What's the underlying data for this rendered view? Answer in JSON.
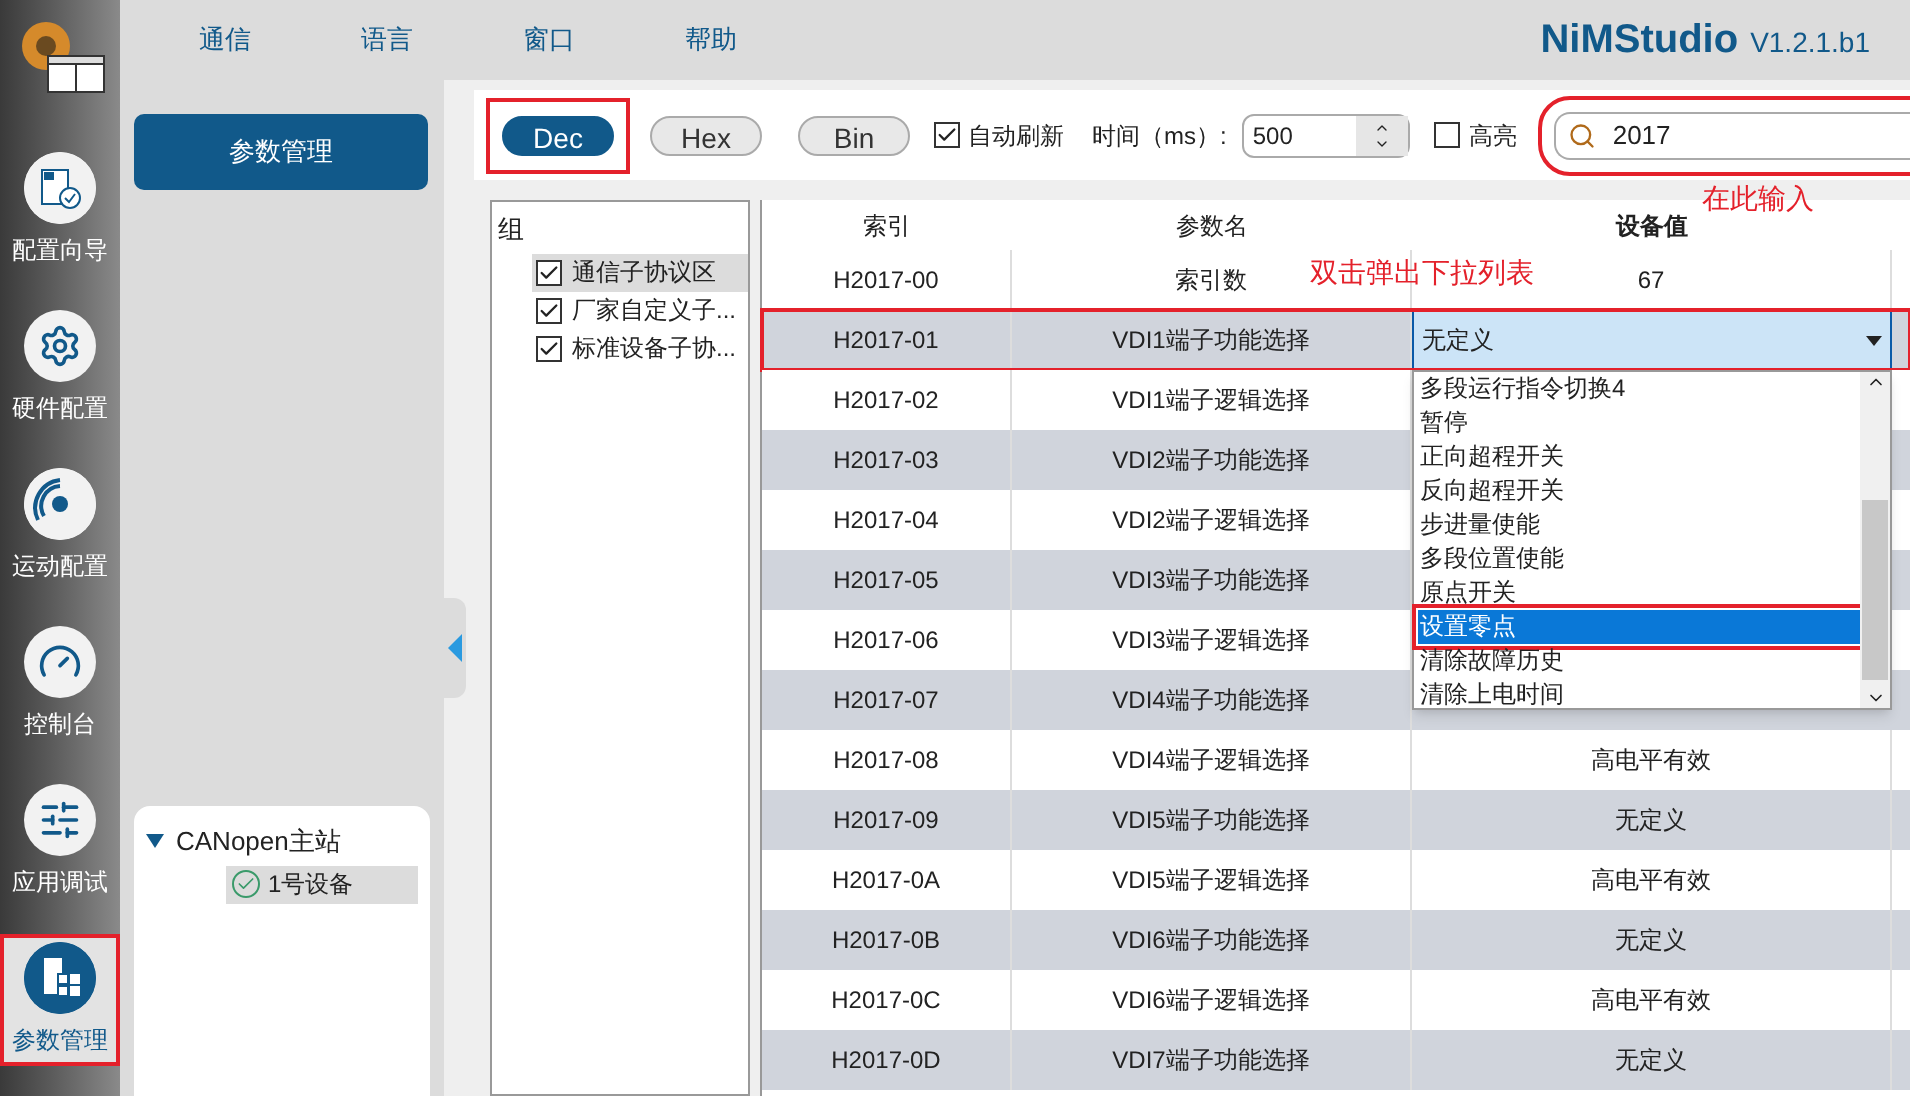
{
  "menu": [
    "通信",
    "语言",
    "窗口",
    "帮助"
  ],
  "app_title": {
    "name": "NiMStudio",
    "version": "V1.2.1.b1"
  },
  "nav": [
    {
      "label": "配置向导",
      "kind": "wizard",
      "selected": false,
      "annotated": false
    },
    {
      "label": "硬件配置",
      "kind": "hardware",
      "selected": false,
      "annotated": false
    },
    {
      "label": "运动配置",
      "kind": "motion",
      "selected": false,
      "annotated": false
    },
    {
      "label": "控制台",
      "kind": "console",
      "selected": false,
      "annotated": false
    },
    {
      "label": "应用调试",
      "kind": "tuning",
      "selected": false,
      "annotated": false
    },
    {
      "label": "参数管理",
      "kind": "params",
      "selected": true,
      "annotated": true
    }
  ],
  "side_button": "参数管理",
  "device_tree": {
    "label": "CANopen主站",
    "expanded": true,
    "children": [
      {
        "label": "1号设备",
        "selected": true
      }
    ]
  },
  "format_buttons": [
    {
      "label": "Dec",
      "selected": true,
      "annotated": true
    },
    {
      "label": "Hex",
      "selected": false,
      "annotated": false
    },
    {
      "label": "Bin",
      "selected": false,
      "annotated": false
    }
  ],
  "auto_refresh": {
    "label": "自动刷新",
    "checked": true
  },
  "interval": {
    "label": "时间（ms）:",
    "value": "500"
  },
  "highlight": {
    "label": "高亮",
    "checked": false
  },
  "search": {
    "value": "2017",
    "annotated": true
  },
  "groups": {
    "title": "组",
    "items": [
      {
        "label": "通信子协议区",
        "checked": true,
        "selected": true
      },
      {
        "label": "厂家自定义子...",
        "checked": true,
        "selected": false
      },
      {
        "label": "标准设备子协...",
        "checked": true,
        "selected": false
      }
    ]
  },
  "table": {
    "columns": [
      "索引",
      "参数名",
      "设备值"
    ],
    "rows": [
      {
        "index": "H2017-00",
        "name": "索引数",
        "value": "67",
        "annotated": false
      },
      {
        "index": "H2017-01",
        "name": "VDI1端子功能选择",
        "editor": {
          "value": "无定义"
        },
        "annotated": true
      },
      {
        "index": "H2017-02",
        "name": "VDI1端子逻辑选择",
        "annotated": false
      },
      {
        "index": "H2017-03",
        "name": "VDI2端子功能选择",
        "annotated": false
      },
      {
        "index": "H2017-04",
        "name": "VDI2端子逻辑选择",
        "annotated": false
      },
      {
        "index": "H2017-05",
        "name": "VDI3端子功能选择",
        "annotated": false
      },
      {
        "index": "H2017-06",
        "name": "VDI3端子逻辑选择",
        "annotated": false
      },
      {
        "index": "H2017-07",
        "name": "VDI4端子功能选择",
        "annotated": false
      },
      {
        "index": "H2017-08",
        "name": "VDI4端子逻辑选择",
        "value": "高电平有效",
        "annotated": false
      },
      {
        "index": "H2017-09",
        "name": "VDI5端子功能选择",
        "value": "无定义",
        "annotated": false
      },
      {
        "index": "H2017-0A",
        "name": "VDI5端子逻辑选择",
        "value": "高电平有效",
        "annotated": false
      },
      {
        "index": "H2017-0B",
        "name": "VDI6端子功能选择",
        "value": "无定义",
        "annotated": false
      },
      {
        "index": "H2017-0C",
        "name": "VDI6端子逻辑选择",
        "value": "高电平有效",
        "annotated": false
      },
      {
        "index": "H2017-0D",
        "name": "VDI7端子功能选择",
        "value": "无定义",
        "annotated": false
      }
    ]
  },
  "dropdown": {
    "options": [
      {
        "label": "多段运行指令切换4",
        "selected": false,
        "annotated": false
      },
      {
        "label": "暂停",
        "selected": false,
        "annotated": false
      },
      {
        "label": "正向超程开关",
        "selected": false,
        "annotated": false
      },
      {
        "label": "反向超程开关",
        "selected": false,
        "annotated": false
      },
      {
        "label": "步进量使能",
        "selected": false,
        "annotated": false
      },
      {
        "label": "多段位置使能",
        "selected": false,
        "annotated": false
      },
      {
        "label": "原点开关",
        "selected": false,
        "annotated": false
      },
      {
        "label": "设置零点",
        "selected": true,
        "annotated": true
      },
      {
        "label": "清除故障历史",
        "selected": false,
        "annotated": false
      },
      {
        "label": "清除上电时间",
        "selected": false,
        "annotated": false
      }
    ]
  },
  "annotations": {
    "search_hint": "在此输入",
    "dropdown_hint": "双击弹出下拉列表"
  }
}
